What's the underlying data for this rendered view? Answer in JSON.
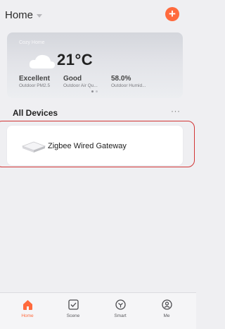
{
  "header": {
    "title": "Home",
    "add_icon": "plus-icon",
    "accent_color": "#ff6a3d"
  },
  "weather": {
    "home_name": "Cozy Home",
    "temperature": "21°C",
    "icon": "cloud-icon",
    "metrics": [
      {
        "value": "Excellent",
        "label": "Outdoor PM2.5"
      },
      {
        "value": "Good",
        "label": "Outdoor Air Qu..."
      },
      {
        "value": "58.0%",
        "label": "Outdoor Humid..."
      }
    ],
    "page_indicator": {
      "pages": 2,
      "current": 1
    }
  },
  "devices": {
    "section_title": "All Devices",
    "more_icon": "more-icon",
    "items": [
      {
        "name": "Zigbee Wired Gateway",
        "icon": "gateway-icon"
      }
    ]
  },
  "tabbar": {
    "tabs": [
      {
        "label": "Home",
        "icon": "home-icon",
        "active": true
      },
      {
        "label": "Scene",
        "icon": "scene-icon",
        "active": false
      },
      {
        "label": "Smart",
        "icon": "smart-icon",
        "active": false
      },
      {
        "label": "Me",
        "icon": "profile-icon",
        "active": false
      }
    ]
  }
}
